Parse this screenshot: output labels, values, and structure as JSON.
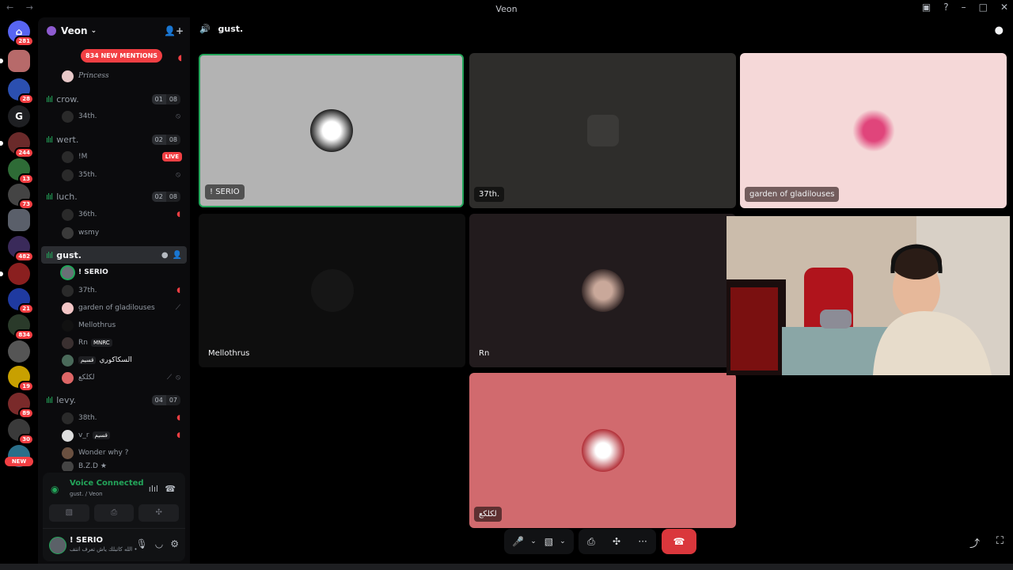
{
  "window": {
    "title": "Veon",
    "nav": "← →",
    "btn_hub": "▣",
    "btn_help": "?",
    "btn_min": "–",
    "btn_max": "□",
    "btn_close": "✕"
  },
  "rail": {
    "badges": [
      "281",
      "28",
      "244",
      "13",
      "73",
      "482",
      "21",
      "834",
      "19",
      "89",
      "30"
    ],
    "letter": "G",
    "new_label": "NEW"
  },
  "guild": {
    "name": "Veon",
    "chevron": "⌄",
    "invite_icon": "👤+"
  },
  "mentions_banner": "834 NEW MENTIONS",
  "channels": [
    {
      "name": "crow.",
      "count_a": "01",
      "count_b": "08"
    },
    {
      "name": "wert.",
      "count_a": "02",
      "count_b": "08"
    },
    {
      "name": "luch.",
      "count_a": "02",
      "count_b": "08"
    },
    {
      "name": "gust."
    },
    {
      "name": "levy.",
      "count_a": "04",
      "count_b": "07"
    }
  ],
  "users": {
    "princess": "Princess",
    "u34": "34th.",
    "im": "!M",
    "live": "LIVE",
    "u35": "35th.",
    "u36": "36th.",
    "wsmy": "wsmy",
    "serio": "! SERIO",
    "u37": "37th.",
    "garden": "garden of gladilouses",
    "mellothrus": "Mellothrus",
    "rn": "Rn",
    "rn_tag": "MNRC",
    "sakakuri": "السكاكوري",
    "sakakuri_tag": "قسيم",
    "lkk": "لكلكع",
    "u38": "38th.",
    "vr": "v_r",
    "vr_tag": "قسيم",
    "wonder": "Wonder why ?",
    "bzd": "B.Z.D ★"
  },
  "voice_panel": {
    "status": "Voice Connected",
    "location": "gust. / Veon"
  },
  "user_panel": {
    "name": "! SERIO",
    "status": "الله كاتبلك ياش تعرف انتف •"
  },
  "stage": {
    "channel": "gust.",
    "tiles": [
      {
        "name": "! SERIO",
        "bg": "#b3b3b3"
      },
      {
        "name": "37th.",
        "bg": "#2e2d2b"
      },
      {
        "name": "garden of gladilouses",
        "bg": "#f5d8d8"
      },
      {
        "name": "Mellothrus",
        "bg": "#0e0e0e"
      },
      {
        "name": "Rn",
        "bg": "#221b1d"
      },
      {
        "name": "لكلكع",
        "bg": "#d16a6e"
      }
    ]
  },
  "controls": {
    "mic": "🎤",
    "cam": "▧",
    "share": "⎙",
    "activity": "✣",
    "more": "···",
    "hangup": "☎"
  },
  "colors": {
    "speaking": "#23a55a",
    "danger": "#f23f43",
    "accent": "#5865f2"
  }
}
